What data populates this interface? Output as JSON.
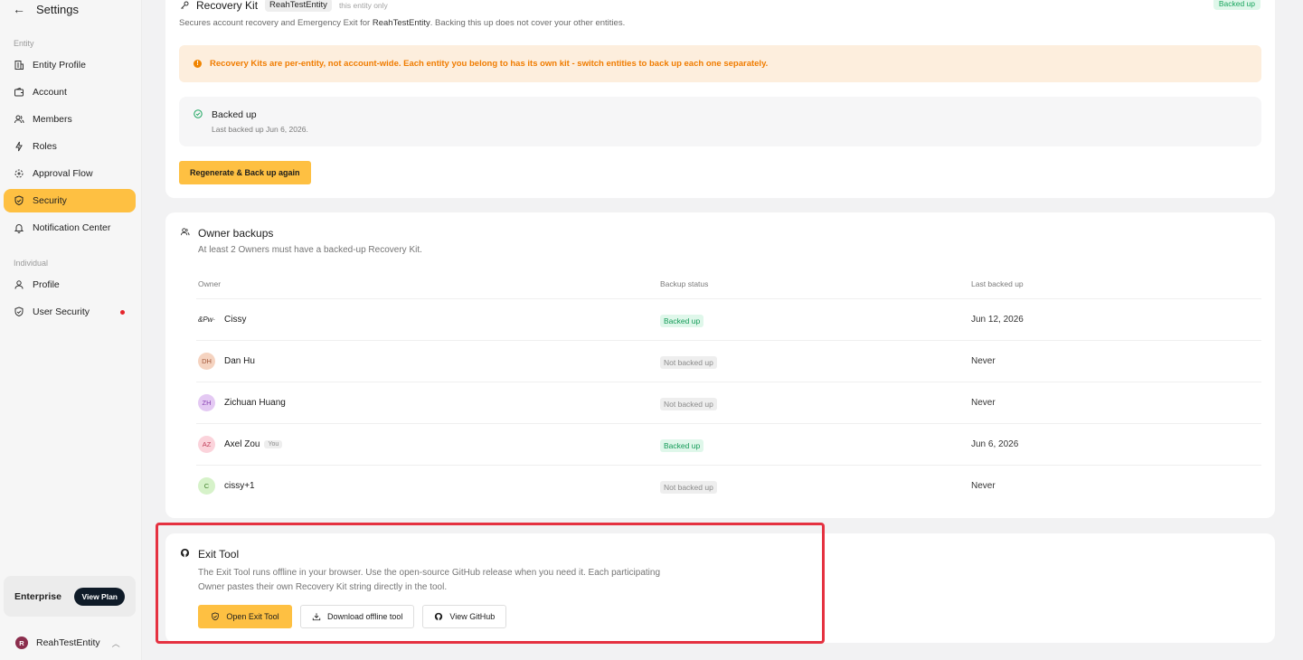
{
  "sidebar": {
    "title": "Settings",
    "back_icon": "arrow-left-icon",
    "section_entity": "Entity",
    "section_individual": "Individual",
    "items": [
      {
        "label": "Entity Profile",
        "icon": "building-icon"
      },
      {
        "label": "Account",
        "icon": "wallet-icon"
      },
      {
        "label": "Members",
        "icon": "users-icon"
      },
      {
        "label": "Roles",
        "icon": "bolt-icon"
      },
      {
        "label": "Approval Flow",
        "icon": "flow-icon"
      },
      {
        "label": "Security",
        "icon": "shield-icon",
        "active": true
      },
      {
        "label": "Notification Center",
        "icon": "bell-icon"
      },
      {
        "label": "Profile",
        "icon": "user-icon"
      },
      {
        "label": "User Security",
        "icon": "shield-icon",
        "has_alert": true
      }
    ],
    "plan": {
      "name": "Enterprise",
      "button": "View Plan"
    },
    "entity": {
      "initial": "R",
      "name": "ReahTestEntity"
    }
  },
  "recovery_kit": {
    "title": "Recovery Kit",
    "entity_chip": "ReahTestEntity",
    "scope": "this entity only",
    "badge": "Backed up",
    "desc_prefix": "Secures account recovery and Emergency Exit for ",
    "desc_entity": "ReahTestEntity",
    "desc_suffix": ". Backing this up does not cover your other entities.",
    "warning": "Recovery Kits are per-entity, not account-wide. Each entity you belong to has its own kit - switch entities to back up each one separately.",
    "status_title": "Backed up",
    "status_sub": "Last backed up Jun 6, 2026.",
    "button": "Regenerate & Back up again"
  },
  "owner_backups": {
    "title": "Owner backups",
    "subtitle": "At least 2 Owners must have a backed-up Recovery Kit.",
    "columns": [
      "Owner",
      "Backup status",
      "Last backed up"
    ],
    "rows": [
      {
        "avatar": "&Pw·",
        "name": "Cissy",
        "you": "",
        "status": "Backed up",
        "ok": true,
        "last": "Jun 12, 2026"
      },
      {
        "avatar": "DH",
        "name": "Dan Hu",
        "you": "",
        "status": "Not backed up",
        "ok": false,
        "last": "Never"
      },
      {
        "avatar": "ZH",
        "name": "Zichuan Huang",
        "you": "",
        "status": "Not backed up",
        "ok": false,
        "last": "Never"
      },
      {
        "avatar": "AZ",
        "name": "Axel Zou",
        "you": "You",
        "status": "Backed up",
        "ok": true,
        "last": "Jun 6, 2026"
      },
      {
        "avatar": "C",
        "name": "cissy+1",
        "you": "",
        "status": "Not backed up",
        "ok": false,
        "last": "Never"
      }
    ],
    "avatar_colors": [
      "#ffffff",
      "#f5d3c0",
      "#e4c9f3",
      "#fbd3db",
      "#d6f2c9"
    ],
    "avatar_text_colors": [
      "#222222",
      "#a2583a",
      "#8a44b3",
      "#c0405b",
      "#3f7f2a"
    ]
  },
  "exit_tool": {
    "title": "Exit Tool",
    "desc": "The Exit Tool runs offline in your browser. Use the open-source GitHub release when you need it. Each participating Owner pastes their own Recovery Kit string directly in the tool.",
    "buttons": {
      "open": "Open Exit Tool",
      "download": "Download offline tool",
      "github": "View GitHub"
    }
  },
  "colors": {
    "accent": "#fec042",
    "success": "#18a55d",
    "warning": "#f07c00",
    "highlight": "#e53140"
  }
}
